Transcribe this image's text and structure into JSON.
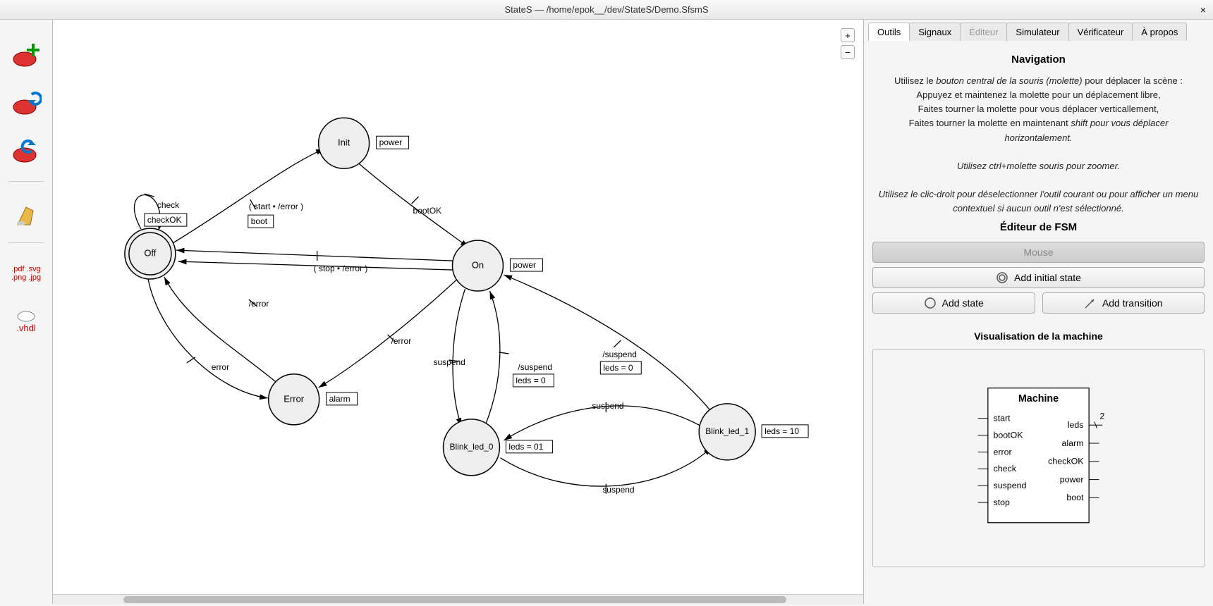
{
  "window": {
    "title": "StateS — /home/epok__/dev/StateS/Demo.SfsmS",
    "close": "×"
  },
  "zoom": {
    "plus": "+",
    "minus": "−"
  },
  "toolbar": {
    "new": "new",
    "open": "open",
    "save": "save",
    "clear": "clear",
    "export_img": ".pdf .svg\n.png .jpg",
    "export_vhdl": ".vhdl"
  },
  "diagram": {
    "states": {
      "init": {
        "label": "Init",
        "output": "power"
      },
      "off": {
        "label": "Off",
        "output": "checkOK"
      },
      "on": {
        "label": "On",
        "output": "power"
      },
      "error": {
        "label": "Error",
        "output": "alarm"
      },
      "bl0": {
        "label": "Blink_led_0",
        "output": "leds = 01"
      },
      "bl1": {
        "label": "Blink_led_1",
        "output": "leds = 10"
      }
    },
    "transitions": {
      "off_self": "check",
      "off_to_init": "( start • /error )",
      "off_to_init_action": "boot",
      "init_to_on": "bootOK",
      "on_to_off": "( stop • /error )",
      "on_to_error": "/error",
      "off_to_error": "error",
      "error_label": "/error",
      "on_to_bl0": "suspend",
      "bl0_to_on": "/suspend",
      "bl0_to_on_action": "leds = 0",
      "bl1_to_on": "/suspend",
      "bl1_to_on_action": "leds = 0",
      "bl0_to_bl1": "suspend",
      "bl1_to_bl0": "suspend"
    }
  },
  "tabs": {
    "outils": "Outils",
    "signaux": "Signaux",
    "editeur": "Éditeur",
    "simulateur": "Simulateur",
    "verificateur": "Vérificateur",
    "apropos": "À propos"
  },
  "nav": {
    "heading": "Navigation",
    "line1a": "Utilisez le ",
    "line1b": "bouton central de la souris (molette)",
    "line1c": " pour déplacer la scène :",
    "line2": "Appuyez et maintenez la molette pour un déplacement libre,",
    "line3": "Faites tourner la molette pour vous déplacer verticallement,",
    "line4a": "Faites tourner la molette en maintenant ",
    "line4b": "shift pour vous déplacer horizontalement.",
    "line5a": "Utilisez ",
    "line5b": "ctrl+molette souris pour zoomer.",
    "line6a": "Utilisez le ",
    "line6b": "clic-droit pour déselectionner l'outil courant ou pour afficher un menu contextuel si aucun outil n'est sélectionné."
  },
  "fsm_editor": {
    "heading": "Éditeur de FSM",
    "mouse": "Mouse",
    "add_initial": "Add initial state",
    "add_state": "Add state",
    "add_transition": "Add transition"
  },
  "machine_viz": {
    "heading": "Visualisation de la machine",
    "title": "Machine",
    "inputs": [
      "start",
      "bootOK",
      "error",
      "check",
      "suspend",
      "stop"
    ],
    "outputs": [
      "leds",
      "alarm",
      "checkOK",
      "power",
      "boot"
    ],
    "leds_width": "2"
  }
}
